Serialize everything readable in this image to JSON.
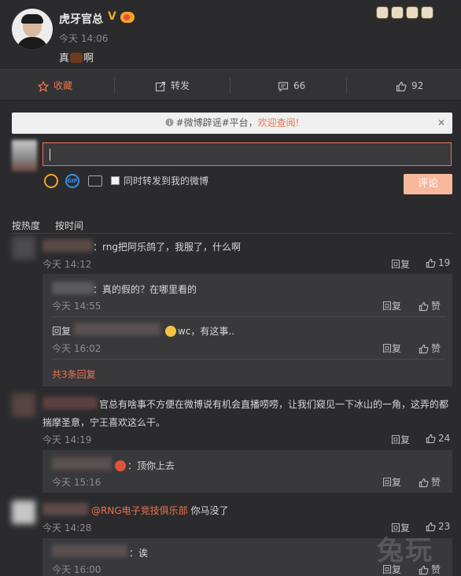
{
  "post": {
    "author": "虎牙官总",
    "verified_mark": "V",
    "time": "今天 14:06",
    "text_before": "真",
    "text_after": "啊"
  },
  "actions": {
    "favorite": "收藏",
    "forward": "转发",
    "comment_count": "66",
    "like_count": "92"
  },
  "rumor": {
    "text": "#微博辟谣#平台，",
    "link": "欢迎查阅!",
    "close": "✕"
  },
  "composer": {
    "forward_label": "同时转发到我的微博",
    "submit": "评论",
    "gif": "GIF"
  },
  "sort": {
    "hot": "按热度",
    "time": "按时间"
  },
  "comments": [
    {
      "text": "：rng把阿乐鸽了，我服了，什么啊",
      "time": "今天 14:12",
      "reply": "回复",
      "likes": "19",
      "replies": [
        {
          "text": "：真的假的？在哪里看的",
          "time": "今天 14:55",
          "reply": "回复",
          "like": "赞"
        },
        {
          "prefix": "回复",
          "text": "wc，有这事..",
          "time": "今天 16:02",
          "reply": "回复",
          "like": "赞"
        }
      ],
      "more": "共3条回复"
    },
    {
      "text": "官总有啥事不方便在微博说有机会直播唠唠，让我们窥见一下冰山的一角，这弄的都",
      "text2": "揣摩圣意，宁王喜欢这么干。",
      "time": "今天 14:19",
      "reply": "回复",
      "likes": "24",
      "replies": [
        {
          "text": "：顶你上去",
          "time": "今天 15:16",
          "reply": "回复",
          "like": "赞"
        }
      ]
    },
    {
      "mention": "@RNG电子竞技俱乐部",
      "text": " 你马没了",
      "time": "今天 14:28",
      "reply": "回复",
      "likes": "23",
      "replies": [
        {
          "text": "：诶",
          "time": "今天 16:00",
          "reply": "回复",
          "like": "赞"
        }
      ]
    }
  ],
  "watermark": "兔玩"
}
